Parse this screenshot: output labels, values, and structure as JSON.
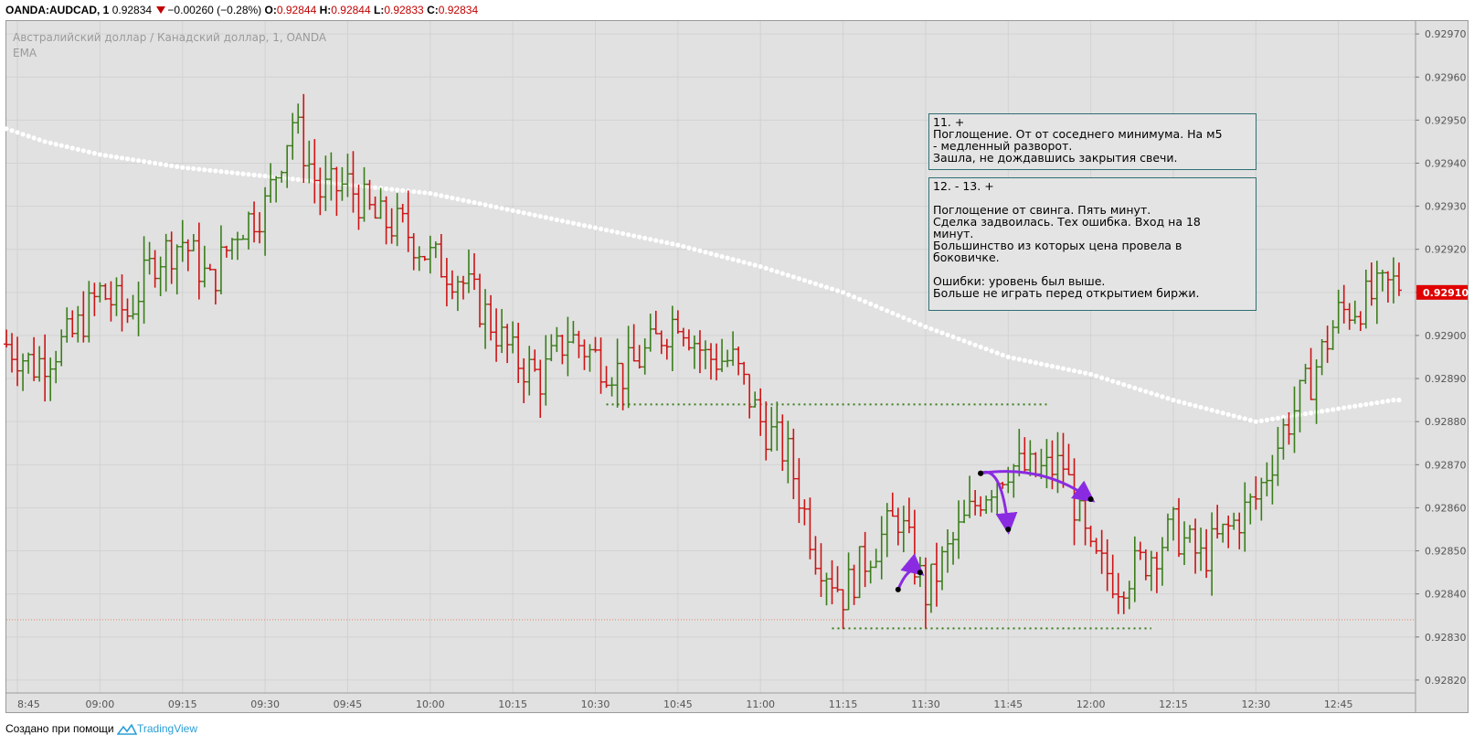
{
  "header": {
    "symbol": "OANDA:AUDCAD, 1",
    "last": "0.92834",
    "change": "−0.00260 (−0.28%)",
    "o_label": "O:",
    "o": "0.92844",
    "h_label": "H:",
    "h": "0.92844",
    "l_label": "L:",
    "l": "0.92833",
    "c_label": "C:",
    "c": "0.92834"
  },
  "pane": {
    "title": "Австралийский доллар / Канадский доллар, 1, OANDA",
    "indicator": "EMA"
  },
  "notes": [
    {
      "text": "11. +\nПоглощение. От от соседнего минимума. На м5\n- медленный разворот.\nЗашла, не дождавшись закрытия свечи."
    },
    {
      "text": "12. -  13. +\n\nПоглощение от свинга. Пять минут.\nСделка задвоилась. Тех ошибка. Вход на 18\nминут.\nБольшинство из которых цена провела в\nбоковичке.\n\nОшибки: уровень был выше.\nБольше не играть перед открытием биржи."
    }
  ],
  "footer": {
    "prefix": "Создано при помощи",
    "brand": "TradingView"
  },
  "colors": {
    "up": "#3a7d1a",
    "down": "#cc1414",
    "ema": "#ffffff",
    "arrow": "#8a2be2",
    "level": "#3a7d1a",
    "last_price": "#e00000"
  },
  "chart_data": {
    "type": "candlestick",
    "y_ticks": [
      "0.92970",
      "0.92960",
      "0.92950",
      "0.92940",
      "0.92930",
      "0.92920",
      "0.92910",
      "0.92900",
      "0.92890",
      "0.92880",
      "0.92870",
      "0.92860",
      "0.92850",
      "0.92840",
      "0.92830",
      "0.92820"
    ],
    "x_ticks": [
      "8:45",
      "09:00",
      "09:15",
      "09:30",
      "09:45",
      "10:00",
      "10:15",
      "10:30",
      "10:45",
      "11:00",
      "11:15",
      "11:30",
      "11:45",
      "12:00",
      "12:15",
      "12:30",
      "12:45"
    ],
    "ylim": [
      0.92817,
      0.92973
    ],
    "last_price_label": "0.92910",
    "last_price": 0.9291,
    "dotted_level": 0.92834,
    "levels": [
      {
        "y": 0.92884,
        "from": "10:32",
        "to": "11:52"
      },
      {
        "y": 0.92832,
        "from": "11:13",
        "to": "12:11"
      }
    ],
    "ema": [
      [
        "08:43",
        0.92948
      ],
      [
        "08:50",
        0.92945
      ],
      [
        "09:00",
        0.92942
      ],
      [
        "09:15",
        0.92939
      ],
      [
        "09:30",
        0.92937
      ],
      [
        "09:45",
        0.92935
      ],
      [
        "10:00",
        0.92933
      ],
      [
        "10:15",
        0.92929
      ],
      [
        "10:30",
        0.92925
      ],
      [
        "10:45",
        0.92921
      ],
      [
        "11:00",
        0.92916
      ],
      [
        "11:15",
        0.9291
      ],
      [
        "11:30",
        0.92902
      ],
      [
        "11:45",
        0.92895
      ],
      [
        "12:00",
        0.92891
      ],
      [
        "12:15",
        0.92885
      ],
      [
        "12:30",
        0.9288
      ],
      [
        "12:40",
        0.92882
      ],
      [
        "12:55",
        0.92885
      ]
    ],
    "candle_path": [
      [
        "08:43",
        0.92898
      ],
      [
        "08:48",
        0.92893
      ],
      [
        "08:55",
        0.929
      ],
      [
        "09:00",
        0.9291
      ],
      [
        "09:05",
        0.92905
      ],
      [
        "09:10",
        0.92918
      ],
      [
        "09:15",
        0.92922
      ],
      [
        "09:20",
        0.92912
      ],
      [
        "09:25",
        0.92925
      ],
      [
        "09:30",
        0.9293
      ],
      [
        "09:35",
        0.9295
      ],
      [
        "09:40",
        0.92933
      ],
      [
        "09:45",
        0.92935
      ],
      [
        "09:50",
        0.92927
      ],
      [
        "09:55",
        0.92925
      ],
      [
        "10:00",
        0.92918
      ],
      [
        "10:05",
        0.92914
      ],
      [
        "10:10",
        0.92905
      ],
      [
        "10:15",
        0.92895
      ],
      [
        "10:20",
        0.9289
      ],
      [
        "10:25",
        0.929
      ],
      [
        "10:30",
        0.92895
      ],
      [
        "10:35",
        0.92891
      ],
      [
        "10:40",
        0.92897
      ],
      [
        "10:45",
        0.92905
      ],
      [
        "10:50",
        0.92895
      ],
      [
        "10:55",
        0.92894
      ],
      [
        "11:00",
        0.9288
      ],
      [
        "11:05",
        0.92872
      ],
      [
        "11:10",
        0.9285
      ],
      [
        "11:15",
        0.9284
      ],
      [
        "11:20",
        0.9285
      ],
      [
        "11:25",
        0.92858
      ],
      [
        "11:30",
        0.9284
      ],
      [
        "11:35",
        0.92852
      ],
      [
        "11:40",
        0.92863
      ],
      [
        "11:45",
        0.9287
      ],
      [
        "11:50",
        0.92868
      ],
      [
        "11:55",
        0.9287
      ],
      [
        "12:00",
        0.92848
      ],
      [
        "12:05",
        0.92843
      ],
      [
        "12:10",
        0.92848
      ],
      [
        "12:15",
        0.92855
      ],
      [
        "12:20",
        0.92848
      ],
      [
        "12:25",
        0.92855
      ],
      [
        "12:30",
        0.92862
      ],
      [
        "12:35",
        0.92878
      ],
      [
        "12:40",
        0.9289
      ],
      [
        "12:45",
        0.92905
      ],
      [
        "12:50",
        0.92908
      ],
      [
        "12:55",
        0.92912
      ]
    ],
    "arrows": [
      {
        "from": [
          "11:25",
          0.92841
        ],
        "to": [
          "11:29",
          0.92845
        ]
      },
      {
        "from": [
          "11:40",
          0.92868
        ],
        "to": [
          "11:45",
          0.92855
        ]
      },
      {
        "from": [
          "11:40",
          0.92868
        ],
        "to": [
          "12:00",
          0.92862
        ]
      }
    ]
  }
}
